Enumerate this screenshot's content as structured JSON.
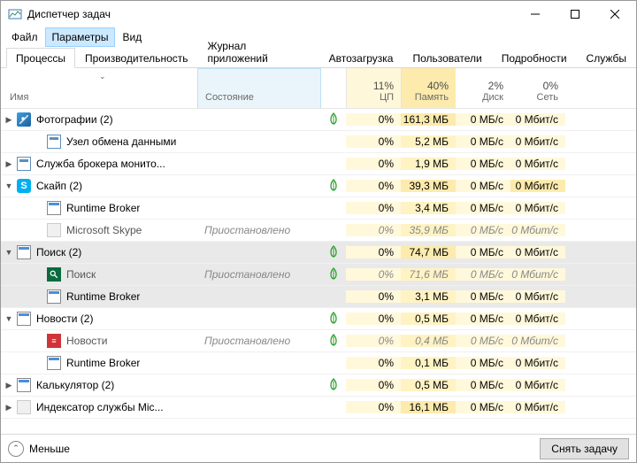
{
  "window": {
    "title": "Диспетчер задач"
  },
  "menu": {
    "file": "Файл",
    "options": "Параметры",
    "view": "Вид"
  },
  "tabs": {
    "processes": "Процессы",
    "performance": "Производительность",
    "apphistory": "Журнал приложений",
    "startup": "Автозагрузка",
    "users": "Пользователи",
    "details": "Подробности",
    "services": "Службы"
  },
  "headers": {
    "name": "Имя",
    "state": "Состояние",
    "cpu_pct": "11%",
    "cpu_label": "ЦП",
    "mem_pct": "40%",
    "mem_label": "Память",
    "disk_pct": "2%",
    "disk_label": "Диск",
    "net_pct": "0%",
    "net_label": "Сеть"
  },
  "state_suspended": "Приостановлено",
  "rows": [
    {
      "expand": ">",
      "icon": "photos",
      "name": "Фотографии (2)",
      "leaf": true,
      "cpu": "0%",
      "mem": "161,3 МБ",
      "disk": "0 МБ/с",
      "net": "0 Мбит/с",
      "memHeavy": true
    },
    {
      "child": true,
      "icon": "node",
      "name": "Узел обмена данными",
      "cpu": "0%",
      "mem": "5,2 МБ",
      "disk": "0 МБ/с",
      "net": "0 Мбит/с"
    },
    {
      "expand": ">",
      "icon": "node",
      "name": "Служба брокера монито...",
      "cpu": "0%",
      "mem": "1,9 МБ",
      "disk": "0 МБ/с",
      "net": "0 Мбит/с"
    },
    {
      "expand": "v",
      "icon": "skype",
      "iconText": "S",
      "name": "Скайп (2)",
      "leaf": true,
      "cpu": "0%",
      "mem": "39,3 МБ",
      "disk": "0 МБ/с",
      "net": "0 Мбит/с",
      "memHeavy": true,
      "netHi": true
    },
    {
      "child": true,
      "icon": "app",
      "name": "Runtime Broker",
      "cpu": "0%",
      "mem": "3,4 МБ",
      "disk": "0 МБ/с",
      "net": "0 Мбит/с"
    },
    {
      "child": true,
      "suspended": true,
      "icon": "blank",
      "name": "Microsoft Skype",
      "state": "Приостановлено",
      "cpu": "0%",
      "mem": "35,9 МБ",
      "disk": "0 МБ/с",
      "net": "0 Мбит/с"
    },
    {
      "expand": "v",
      "sel": true,
      "icon": "app",
      "name": "Поиск (2)",
      "leaf": true,
      "cpu": "0%",
      "mem": "74,7 МБ",
      "disk": "0 МБ/с",
      "net": "0 Мбит/с",
      "memHeavy": true
    },
    {
      "child": true,
      "sel": true,
      "suspended": true,
      "icon": "search",
      "name": "Поиск",
      "state": "Приостановлено",
      "leaf": true,
      "cpu": "0%",
      "mem": "71,6 МБ",
      "disk": "0 МБ/с",
      "net": "0 Мбит/с"
    },
    {
      "child": true,
      "sel": true,
      "icon": "app",
      "name": "Runtime Broker",
      "cpu": "0%",
      "mem": "3,1 МБ",
      "disk": "0 МБ/с",
      "net": "0 Мбит/с"
    },
    {
      "expand": "v",
      "icon": "app",
      "name": "Новости (2)",
      "leaf": true,
      "cpu": "0%",
      "mem": "0,5 МБ",
      "disk": "0 МБ/с",
      "net": "0 Мбит/с"
    },
    {
      "child": true,
      "suspended": true,
      "icon": "news",
      "iconText": "≡",
      "name": "Новости",
      "state": "Приостановлено",
      "leaf": true,
      "cpu": "0%",
      "mem": "0,4 МБ",
      "disk": "0 МБ/с",
      "net": "0 Мбит/с"
    },
    {
      "child": true,
      "icon": "app",
      "name": "Runtime Broker",
      "cpu": "0%",
      "mem": "0,1 МБ",
      "disk": "0 МБ/с",
      "net": "0 Мбит/с"
    },
    {
      "expand": ">",
      "icon": "calc",
      "name": "Калькулятор (2)",
      "leaf": true,
      "cpu": "0%",
      "mem": "0,5 МБ",
      "disk": "0 МБ/с",
      "net": "0 Мбит/с"
    },
    {
      "expand": ">",
      "icon": "blank",
      "name": "Индексатор службы Mic...",
      "cpu": "0%",
      "mem": "16,1 МБ",
      "disk": "0 МБ/с",
      "net": "0 Мбит/с",
      "memHeavy": true
    }
  ],
  "footer": {
    "less": "Меньше",
    "end_task": "Снять задачу"
  }
}
